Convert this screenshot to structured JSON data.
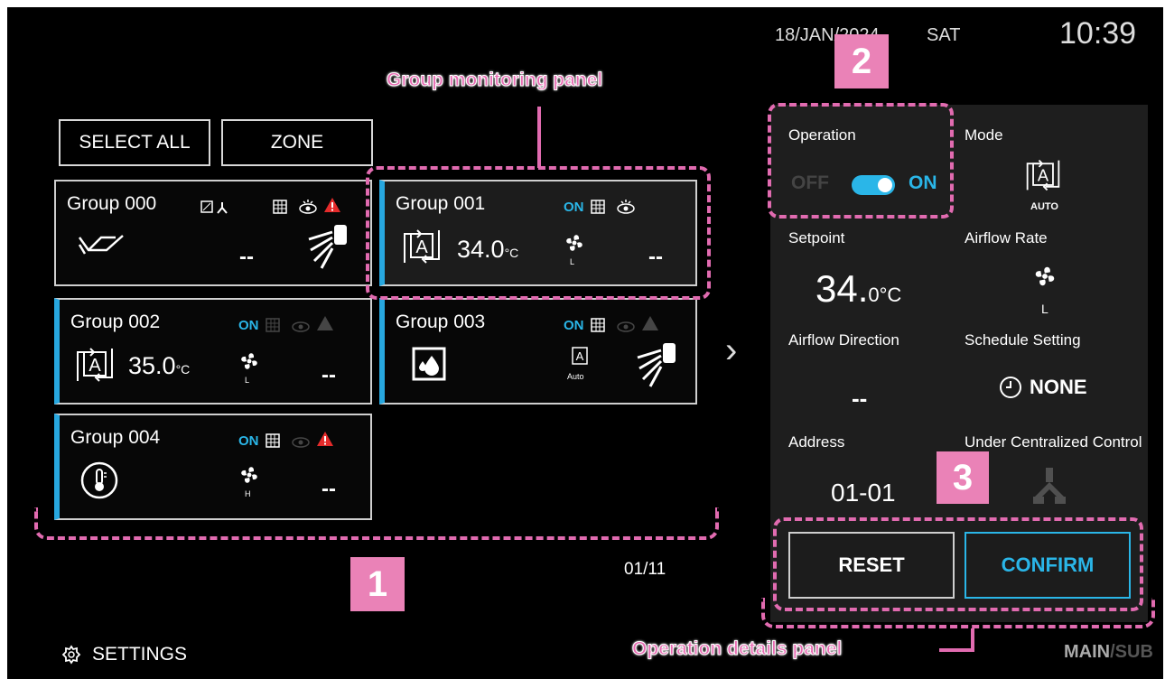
{
  "header": {
    "date": "18/JAN/2024",
    "day": "SAT",
    "time": "10:39"
  },
  "toolbar": {
    "select_all": "SELECT ALL",
    "zone": "ZONE"
  },
  "groups": [
    {
      "name": "Group 000"
    },
    {
      "name": "Group 001",
      "status": "ON",
      "temp": "34.0",
      "unit": "°C",
      "fan": "L",
      "dash": "--"
    },
    {
      "name": "Group 002",
      "status": "ON",
      "temp": "35.0",
      "unit": "°C",
      "fan": "L",
      "dash": "--"
    },
    {
      "name": "Group 003",
      "status": "ON",
      "mode_label": "Auto"
    },
    {
      "name": "Group 004",
      "status": "ON",
      "fan": "H",
      "dash": "--"
    }
  ],
  "group000_dash": "--",
  "pagination": {
    "page": "01/11",
    "next": "›"
  },
  "details": {
    "operation_label": "Operation",
    "off": "OFF",
    "on": "ON",
    "mode_label": "Mode",
    "mode_value": "AUTO",
    "setpoint_label": "Setpoint",
    "setpoint_value": "34.",
    "setpoint_unit": "0°C",
    "airflow_rate_label": "Airflow Rate",
    "airflow_rate_value": "L",
    "airflow_direction_label": "Airflow Direction",
    "airflow_direction_value": "--",
    "schedule_label": "Schedule Setting",
    "schedule_value": "NONE",
    "address_label": "Address",
    "address_value": "01-01",
    "centralized_label": "Under Centralized Control",
    "reset": "RESET",
    "confirm": "CONFIRM"
  },
  "footer": {
    "settings": "SETTINGS",
    "main": "MAIN",
    "sub": "/SUB"
  },
  "annotations": {
    "group_panel": "Group monitoring panel",
    "details_panel": "Operation details panel",
    "n1": "1",
    "n2": "2",
    "n3": "3"
  },
  "colors": {
    "accent": "#2ab6e8",
    "alarm": "#e52b2b",
    "annotation": "#e16bb0"
  }
}
